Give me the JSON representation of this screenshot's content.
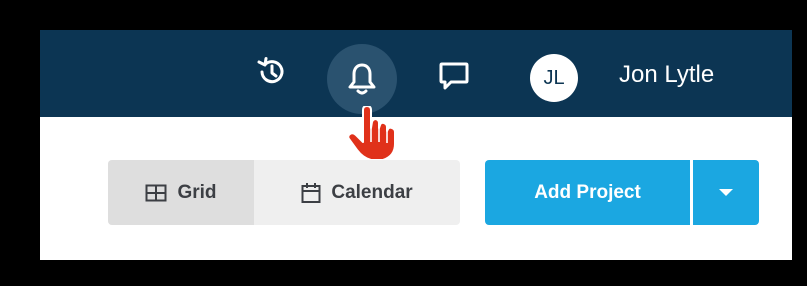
{
  "header": {
    "icons": [
      "history-icon",
      "bell-icon",
      "chat-icon"
    ],
    "user": {
      "initials": "JL",
      "name": "Jon Lytle"
    }
  },
  "view_toggle": {
    "grid_label": "Grid",
    "calendar_label": "Calendar",
    "grid_icon": "grid-icon",
    "calendar_icon": "calendar-icon"
  },
  "actions": {
    "add_project_label": "Add Project",
    "dropdown_icon": "caret-down-icon"
  },
  "colors": {
    "topbar": "#0c3553",
    "bell_highlight": "#2a526f",
    "primary": "#1ba7e1",
    "toggle_bg": "#efefef",
    "toggle_active": "#dedede",
    "cursor": "#e0311a"
  }
}
